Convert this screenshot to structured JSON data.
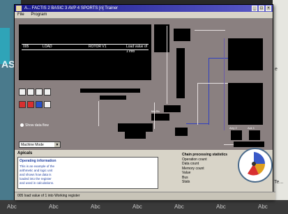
{
  "background": {
    "left_text": "AS",
    "right_fragment": "e",
    "right_label": "Te...",
    "bottom_strip": [
      "Abc",
      "Abc",
      "Abc",
      "Abc",
      "Abc",
      "Abc",
      "Abc"
    ]
  },
  "window": {
    "title": "A...  FACTIS 2 BASIC 3 AVP 4 SPORTS [n] Trainer"
  },
  "menu": [
    "File",
    "Program"
  ],
  "console": {
    "row": [
      "005",
      "LOAD",
      "ROTOR V1",
      "Load value of 1 into"
    ]
  },
  "controls": {
    "radio_label": "Show data flow",
    "mode_select": "Machine Mode",
    "mode_arrow": "▼"
  },
  "panel": {
    "title": "Apicals",
    "desc_title": "Operating information",
    "desc_lines": [
      "This is an example of the",
      "arithmetic and logic unit",
      "and shows how data is",
      "loaded into the register",
      "and used in calculations."
    ]
  },
  "stats": {
    "title": "Chain processing statistics",
    "items": [
      "Operation count",
      "Data count",
      "Memory count",
      "Value",
      "Bus",
      "Stats"
    ]
  },
  "diagram": {
    "labels": [
      "Mu Rb",
      "Arry 2",
      "Ack 1"
    ]
  },
  "status": {
    "text": "005   load value of 1 into Working register"
  },
  "colors": {
    "title_start": "#1a1a8a",
    "title_end": "#5a5ac8",
    "canvas": "#8a8080",
    "accent_wire": "#3040c0",
    "red": "#d83030",
    "blue": "#2850c8"
  }
}
